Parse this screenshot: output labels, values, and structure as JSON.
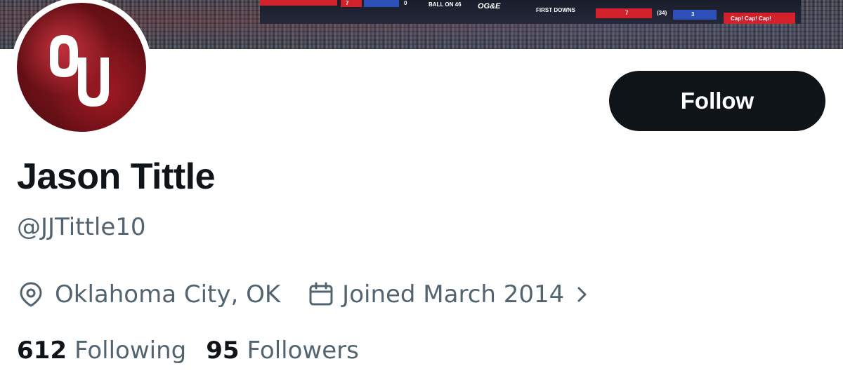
{
  "banner": {
    "scoreboard": {
      "score_left": "7",
      "score_mid": "0",
      "ball_on": "BALL ON 46",
      "sponsor": "OG&E",
      "first_downs": "FIRST DOWNS",
      "fd_home": "7",
      "fd_away": "3",
      "team_away": "(34)",
      "ads": "Cap! Cap! Cap!"
    }
  },
  "profile": {
    "avatar_text": "OU",
    "follow_label": "Follow",
    "display_name": "Jason Tittle",
    "handle": "@JJTittle10",
    "location": "Oklahoma City, OK",
    "joined": "Joined March 2014",
    "following_count": "612",
    "following_label": "Following",
    "followers_count": "95",
    "followers_label": "Followers"
  },
  "icons": {
    "location": "location-pin-icon",
    "calendar": "calendar-icon",
    "chevron": "chevron-right-icon"
  },
  "colors": {
    "text_primary": "#0f1419",
    "text_secondary": "#536471",
    "button_bg": "#0f1419",
    "avatar_red": "#8b1a22"
  }
}
